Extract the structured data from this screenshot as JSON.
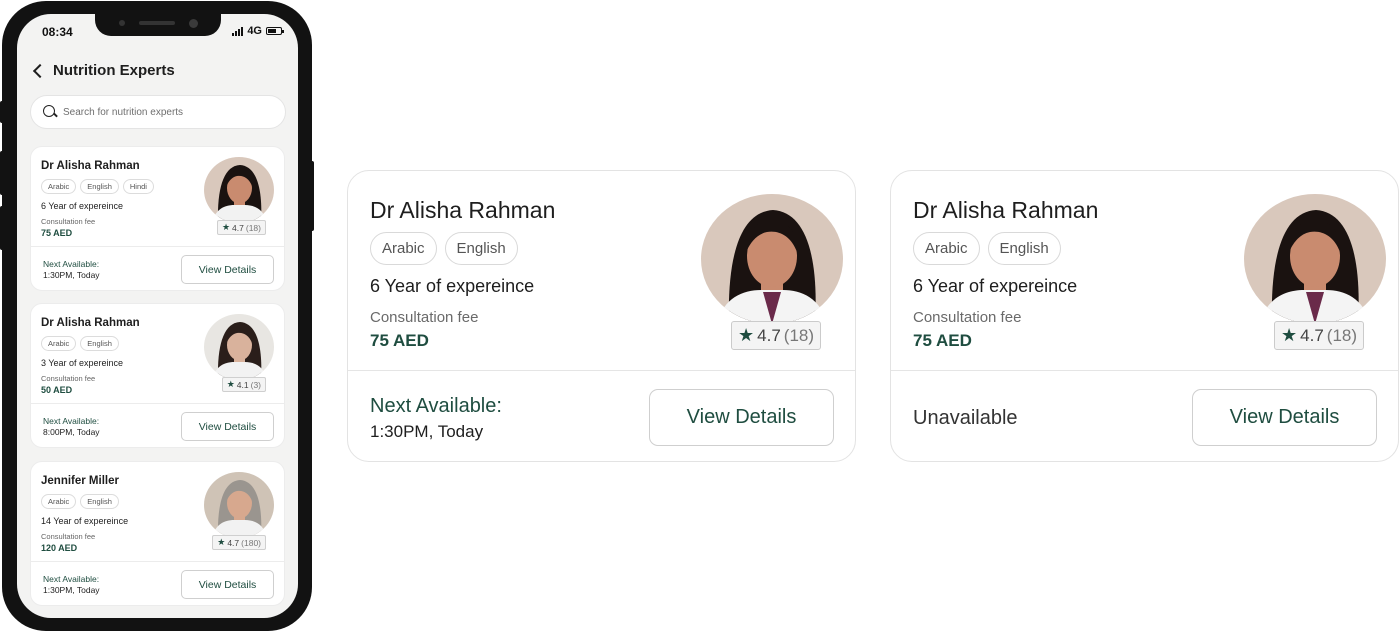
{
  "phone": {
    "status": {
      "time": "08:34",
      "network": "4G"
    },
    "header": {
      "title": "Nutrition Experts"
    },
    "search": {
      "placeholder": "Search for nutrition experts"
    },
    "cards": [
      {
        "name": "Dr Alisha Rahman",
        "languages": [
          "Arabic",
          "English",
          "Hindi"
        ],
        "experience": "6 Year of expereince",
        "fee_label": "Consultation fee",
        "fee": "75 AED",
        "rating": "4.7",
        "rating_count": "(18)",
        "avail_label": "Next Available:",
        "avail_value": "1:30PM, Today",
        "button": "View Details",
        "avatar_skin": "#c98b6f",
        "avatar_hair": "#1a1210",
        "avatar_bg": "#d9c8bc"
      },
      {
        "name": "Dr Alisha Rahman",
        "languages": [
          "Arabic",
          "English"
        ],
        "experience": "3 Year of expereince",
        "fee_label": "Consultation fee",
        "fee": "50 AED",
        "rating": "4.1",
        "rating_count": "(3)",
        "avail_label": "Next Available:",
        "avail_value": "8:00PM, Today",
        "button": "View Details",
        "avatar_skin": "#d9b29c",
        "avatar_hair": "#2a1e1a",
        "avatar_bg": "#e8e6e2"
      },
      {
        "name": "Jennifer Miller",
        "languages": [
          "Arabic",
          "English"
        ],
        "experience": "14 Year of expereince",
        "fee_label": "Consultation fee",
        "fee": "120 AED",
        "rating": "4.7",
        "rating_count": "(180)",
        "avail_label": "Next Available:",
        "avail_value": "1:30PM, Today",
        "button": "View Details",
        "avatar_skin": "#d7a88e",
        "avatar_hair": "#9a958f",
        "avatar_bg": "#cfc3b6"
      }
    ]
  },
  "large_cards": [
    {
      "name": "Dr Alisha Rahman",
      "languages": [
        "Arabic",
        "English"
      ],
      "experience": "6 Year of expereince",
      "fee_label": "Consultation fee",
      "fee": "75 AED",
      "rating": "4.7",
      "rating_count": "(18)",
      "avail_label": "Next Available:",
      "avail_value": "1:30PM, Today",
      "button": "View Details"
    },
    {
      "name": "Dr Alisha Rahman",
      "languages": [
        "Arabic",
        "English"
      ],
      "experience": "6 Year of expereince",
      "fee_label": "Consultation fee",
      "fee": "75 AED",
      "rating": "4.7",
      "rating_count": "(18)",
      "unavailable": "Unavailable",
      "button": "View Details"
    }
  ],
  "colors": {
    "brand_green": "#1f4d40",
    "text": "#1e1e1e",
    "muted": "#6a6a6a",
    "border": "#e3e3e3"
  },
  "icons": {
    "back": "chevron-left-icon",
    "search": "search-icon",
    "rating": "star-icon"
  }
}
